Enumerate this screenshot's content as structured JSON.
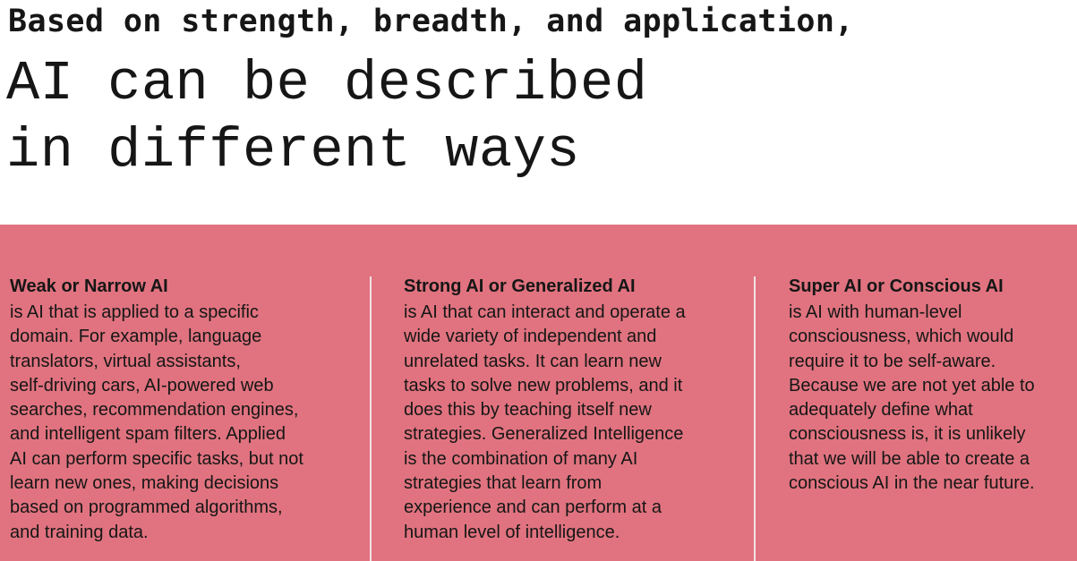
{
  "header": {
    "subtitle": "Based on strength, breadth, and application,",
    "title_lines": [
      "AI can be described",
      "in different ways"
    ]
  },
  "theme": {
    "panel_color": "#e0737f",
    "text_color": "#161616",
    "divider_color": "#f2e3e5"
  },
  "columns": [
    {
      "heading": "Weak or Narrow AI",
      "lines": [
        "is AI that is applied to a specific",
        "domain. For example, language",
        "translators, virtual assistants,",
        "self-driving cars, AI-powered web",
        "searches, recommendation engines,",
        "and intelligent spam filters. Applied",
        "AI can perform specific tasks, but not",
        "learn new ones, making decisions",
        "based on programmed algorithms,",
        "and training data."
      ]
    },
    {
      "heading": "Strong AI or Generalized AI",
      "lines": [
        "is AI that can interact and operate a",
        "wide variety of independent and",
        "unrelated tasks. It can learn new",
        "tasks to solve new problems, and it",
        "does this by teaching itself new",
        "strategies. Generalized Intelligence",
        "is the combination of many AI",
        "strategies that learn from",
        "experience and can perform at a",
        "human level of intelligence."
      ]
    },
    {
      "heading": "Super AI or Conscious AI",
      "lines": [
        "is AI with human-level",
        "consciousness, which would",
        "require it to be self-aware.",
        "Because we are not yet able to",
        "adequately define what",
        "consciousness is, it is unlikely",
        "that we will be able to create a",
        "conscious AI in the near future."
      ]
    }
  ]
}
